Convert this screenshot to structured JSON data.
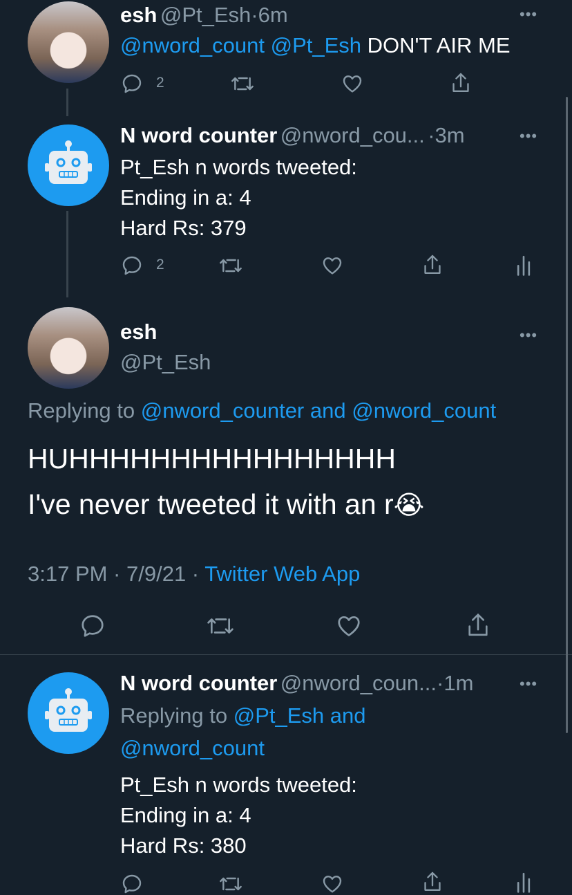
{
  "tweet1": {
    "name": "esh",
    "handle": "@Pt_Esh",
    "sep": "·",
    "time": "6m",
    "mention1": "@nword_count",
    "mention2": "@Pt_Esh",
    "text": "DON'T AIR ME",
    "reply_count": "2"
  },
  "tweet2": {
    "name": "N word counter",
    "handle": "@nword_cou...",
    "time": "·3m",
    "lines": [
      "Pt_Esh n words tweeted:",
      "Ending in a: 4",
      "Hard Rs: 379"
    ],
    "reply_count": "2"
  },
  "tweet3": {
    "name": "esh",
    "handle": "@Pt_Esh",
    "replying_prefix": "Replying to",
    "replying_to1": "@nword_counter",
    "replying_and": "and",
    "replying_to2": "@nword_count",
    "line1": "HUHHHHHHHHHHHHHHHH",
    "line2": "I've never tweeted it with an r",
    "emoji": "😭",
    "timestamp": "3:17 PM · 7/9/21 ·",
    "source": "Twitter Web App"
  },
  "tweet4": {
    "name": "N word counter",
    "handle": "@nword_coun...",
    "time": "·1m",
    "replying_prefix": "Replying to",
    "replying_to1": "@Pt_Esh",
    "replying_and": "and",
    "replying_to2": "@nword_count",
    "lines": [
      "Pt_Esh n words tweeted:",
      "Ending in a: 4",
      "Hard Rs: 380"
    ]
  },
  "more_glyph": "•••",
  "icons": [
    "reply-icon",
    "retweet-icon",
    "like-icon",
    "share-icon",
    "analytics-icon",
    "bot-icon"
  ],
  "colors": {
    "background": "#15202b",
    "accent": "#1d9bf0",
    "muted": "#8899a6",
    "divider": "#38444d"
  }
}
